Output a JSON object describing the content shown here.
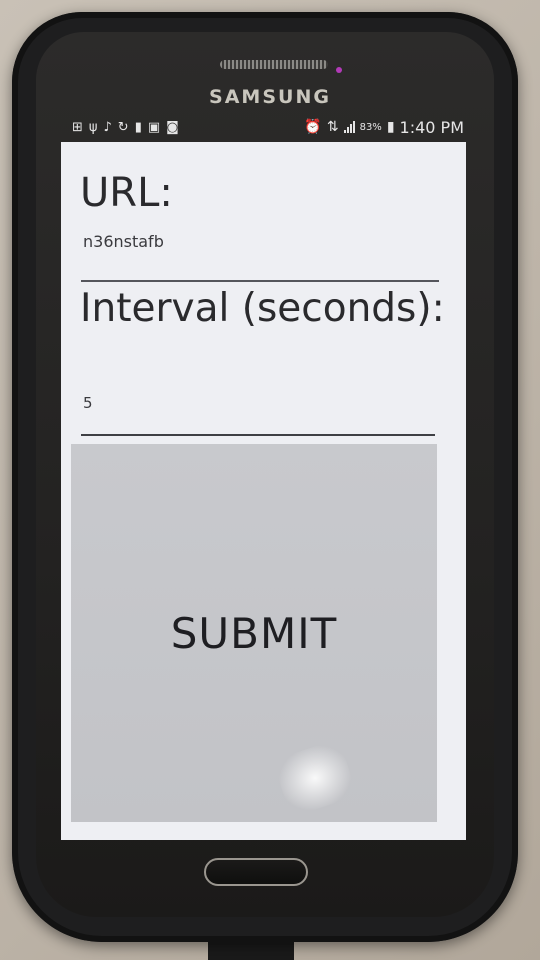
{
  "device": {
    "brand": "SAMSUNG"
  },
  "status_bar": {
    "battery_percent": "83%",
    "time": "1:40 PM",
    "icons": [
      "add-icon",
      "usb-icon",
      "twitter-icon",
      "refresh-icon",
      "file-icon",
      "messages-icon",
      "photo-icon",
      "alarm-icon",
      "wifi-icon",
      "signal-icon",
      "battery-icon"
    ]
  },
  "form": {
    "url_label": "URL:",
    "url_value": "n36nstafb",
    "interval_label": "Interval (seconds):",
    "interval_value": "5",
    "submit_label": "SUBMIT"
  },
  "colors": {
    "screen_background": "#eeeff3",
    "button_background": "#c5c6ca",
    "text": "#2a2a2d",
    "phone_body": "#232221"
  }
}
